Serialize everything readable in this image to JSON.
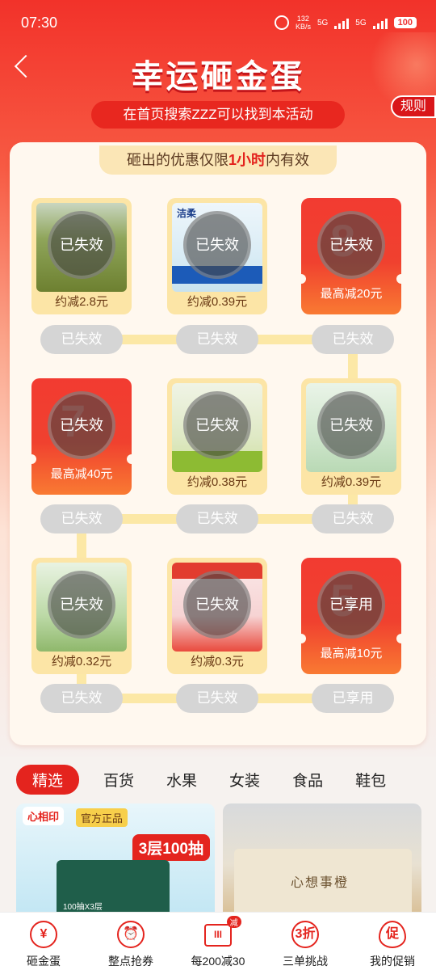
{
  "status_bar": {
    "time": "07:30",
    "speed_value": "132",
    "speed_unit": "KB/s",
    "net1": "5G",
    "net2": "5G",
    "battery": "100"
  },
  "header": {
    "title": "幸运砸金蛋",
    "subtitle": "在首页搜索ZZZ可以找到本活动",
    "rules_label": "规则"
  },
  "notice": {
    "prefix": "砸出的优惠仅限",
    "highlight": "1小时",
    "suffix": "内有效"
  },
  "rows": [
    {
      "tiles": [
        {
          "kind": "product",
          "stamp": "已失效",
          "price": "约减2.8元",
          "status": "已失效"
        },
        {
          "kind": "product",
          "brand": "洁柔",
          "stamp": "已失效",
          "price": "约减0.39元",
          "status": "已失效"
        },
        {
          "kind": "coupon",
          "discount": "8",
          "stamp": "已失效",
          "price": "最高减20元",
          "status": "已失效"
        }
      ]
    },
    {
      "tiles": [
        {
          "kind": "coupon",
          "discount": "7",
          "stamp": "已失效",
          "price": "最高减40元",
          "status": "已失效"
        },
        {
          "kind": "product",
          "stamp": "已失效",
          "price": "约减0.38元",
          "status": "已失效"
        },
        {
          "kind": "product",
          "stamp": "已失效",
          "price": "约减0.39元",
          "status": "已失效"
        }
      ]
    },
    {
      "tiles": [
        {
          "kind": "product",
          "stamp": "已失效",
          "price": "约减0.32元",
          "status": "已失效"
        },
        {
          "kind": "product",
          "stamp": "已失效",
          "price": "约减0.3元",
          "status": "已失效"
        },
        {
          "kind": "coupon",
          "discount": "5",
          "stamp": "已享用",
          "price": "最高减10元",
          "status": "已享用"
        }
      ]
    }
  ],
  "categories": {
    "tabs": [
      "精选",
      "百货",
      "水果",
      "女装",
      "食品",
      "鞋包"
    ],
    "active_index": 0
  },
  "products": [
    {
      "logo": "心相印",
      "tag": "官方正品",
      "badge": "3层100抽",
      "pack_text": "100抽X3层"
    },
    {
      "mat_text": "心想事橙"
    }
  ],
  "bottom_nav": [
    {
      "icon_text": "¥",
      "label": "砸金蛋"
    },
    {
      "icon_text": "⏰",
      "label": "整点抢券"
    },
    {
      "icon_text": "III",
      "label": "每200减30",
      "badge": "减"
    },
    {
      "icon_text": "3折",
      "label": "三单挑战"
    },
    {
      "icon_text": "促",
      "label": "我的促销"
    }
  ],
  "colors": {
    "primary": "#e4241e",
    "pill_gray": "#d5d5d5",
    "tile_gold": "#fce5a6"
  }
}
